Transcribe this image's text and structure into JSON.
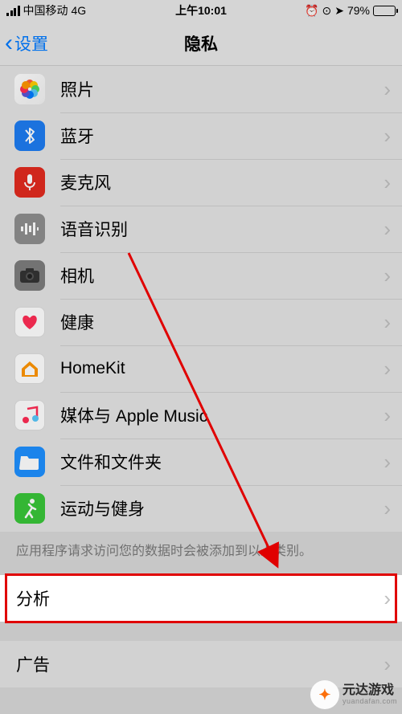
{
  "status": {
    "carrier": "中国移动",
    "network": "4G",
    "time": "上午10:01",
    "battery_pct": "79%",
    "battery_fill": 79
  },
  "nav": {
    "back_label": "设置",
    "title": "隐私"
  },
  "privacy_items": [
    {
      "id": "photos",
      "label": "照片"
    },
    {
      "id": "bluetooth",
      "label": "蓝牙"
    },
    {
      "id": "microphone",
      "label": "麦克风"
    },
    {
      "id": "speech",
      "label": "语音识别"
    },
    {
      "id": "camera",
      "label": "相机"
    },
    {
      "id": "health",
      "label": "健康"
    },
    {
      "id": "homekit",
      "label": "HomeKit"
    },
    {
      "id": "music",
      "label": "媒体与 Apple Music"
    },
    {
      "id": "files",
      "label": "文件和文件夹"
    },
    {
      "id": "motion",
      "label": "运动与健身"
    }
  ],
  "footer_text": "应用程序请求访问您的数据时会被添加到以上类别。",
  "section2": [
    {
      "id": "analytics",
      "label": "分析"
    },
    {
      "id": "advertising",
      "label": "广告"
    }
  ],
  "annotation": {
    "highlight_target": "analytics",
    "arrow_from": "camera",
    "arrow_to": "analytics"
  },
  "watermark": {
    "main": "元达游戏",
    "sub": "yuandafan.com"
  }
}
